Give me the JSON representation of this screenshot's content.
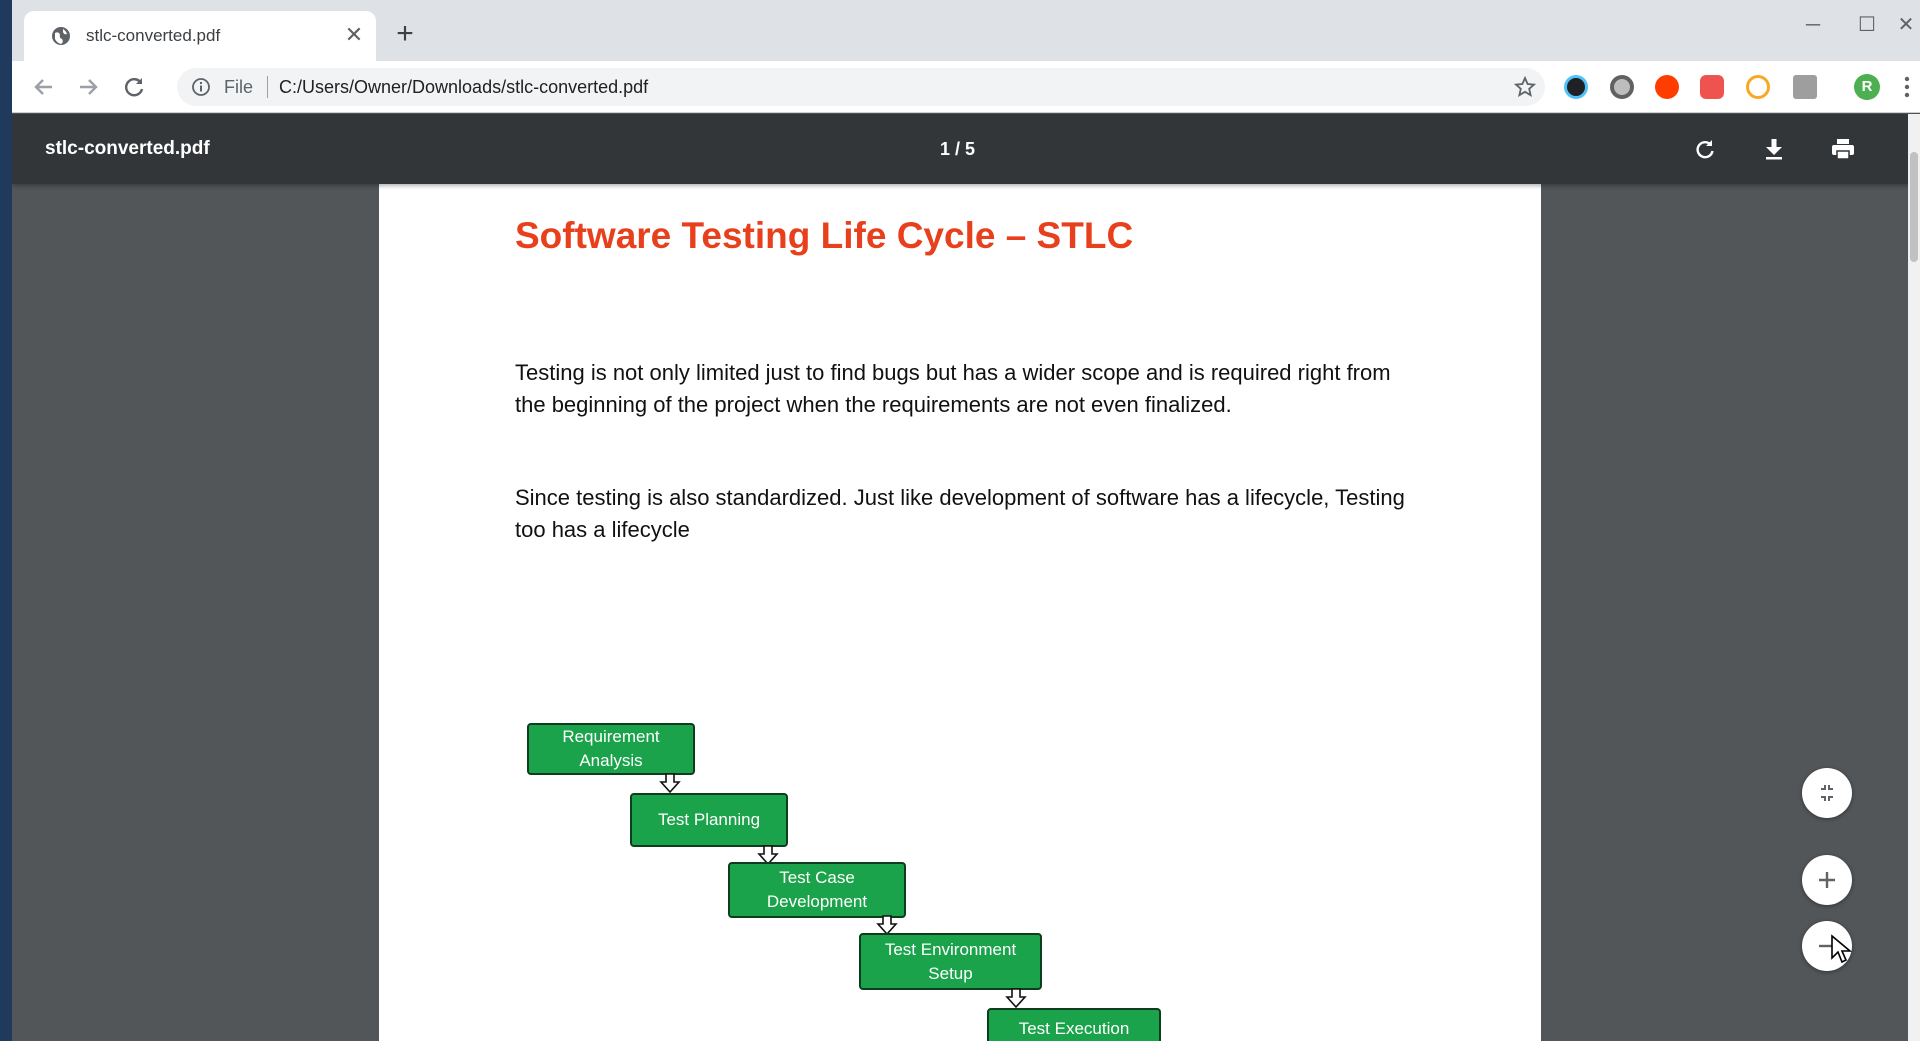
{
  "browser": {
    "tab_title": "stlc-converted.pdf",
    "new_tab_label": "+",
    "url_scheme": "File",
    "url": "C:/Users/Owner/Downloads/stlc-converted.pdf",
    "profile_initial": "R"
  },
  "pdf": {
    "file_name": "stlc-converted.pdf",
    "page_indicator": "1 / 5"
  },
  "document": {
    "title": "Software Testing Life Cycle – STLC",
    "paragraph1": "Testing is not only limited just to find bugs but has a wider scope and is required right from the beginning of the project when the requirements are not even finalized.",
    "paragraph2": "Since testing is also standardized. Just like development of software has a lifecycle, Testing too has a lifecycle",
    "flow": [
      "Requirement Analysis",
      "Test Planning",
      "Test Case Development",
      "Test Environment Setup",
      "Test Execution"
    ]
  },
  "colors": {
    "title_red": "#e8401c",
    "flow_green": "#1aa34a",
    "viewer_bg": "#525659",
    "viewer_toolbar": "#323639"
  },
  "icons": {
    "tab": "globe-icon",
    "back": "back-arrow-icon",
    "forward": "forward-arrow-icon",
    "reload": "reload-icon",
    "info": "info-icon",
    "bookmark": "star-icon",
    "rotate": "rotate-icon",
    "download": "download-icon",
    "print": "print-icon",
    "fit": "fit-to-page-icon",
    "zoom_in": "zoom-in-icon",
    "zoom_out": "zoom-out-icon"
  }
}
